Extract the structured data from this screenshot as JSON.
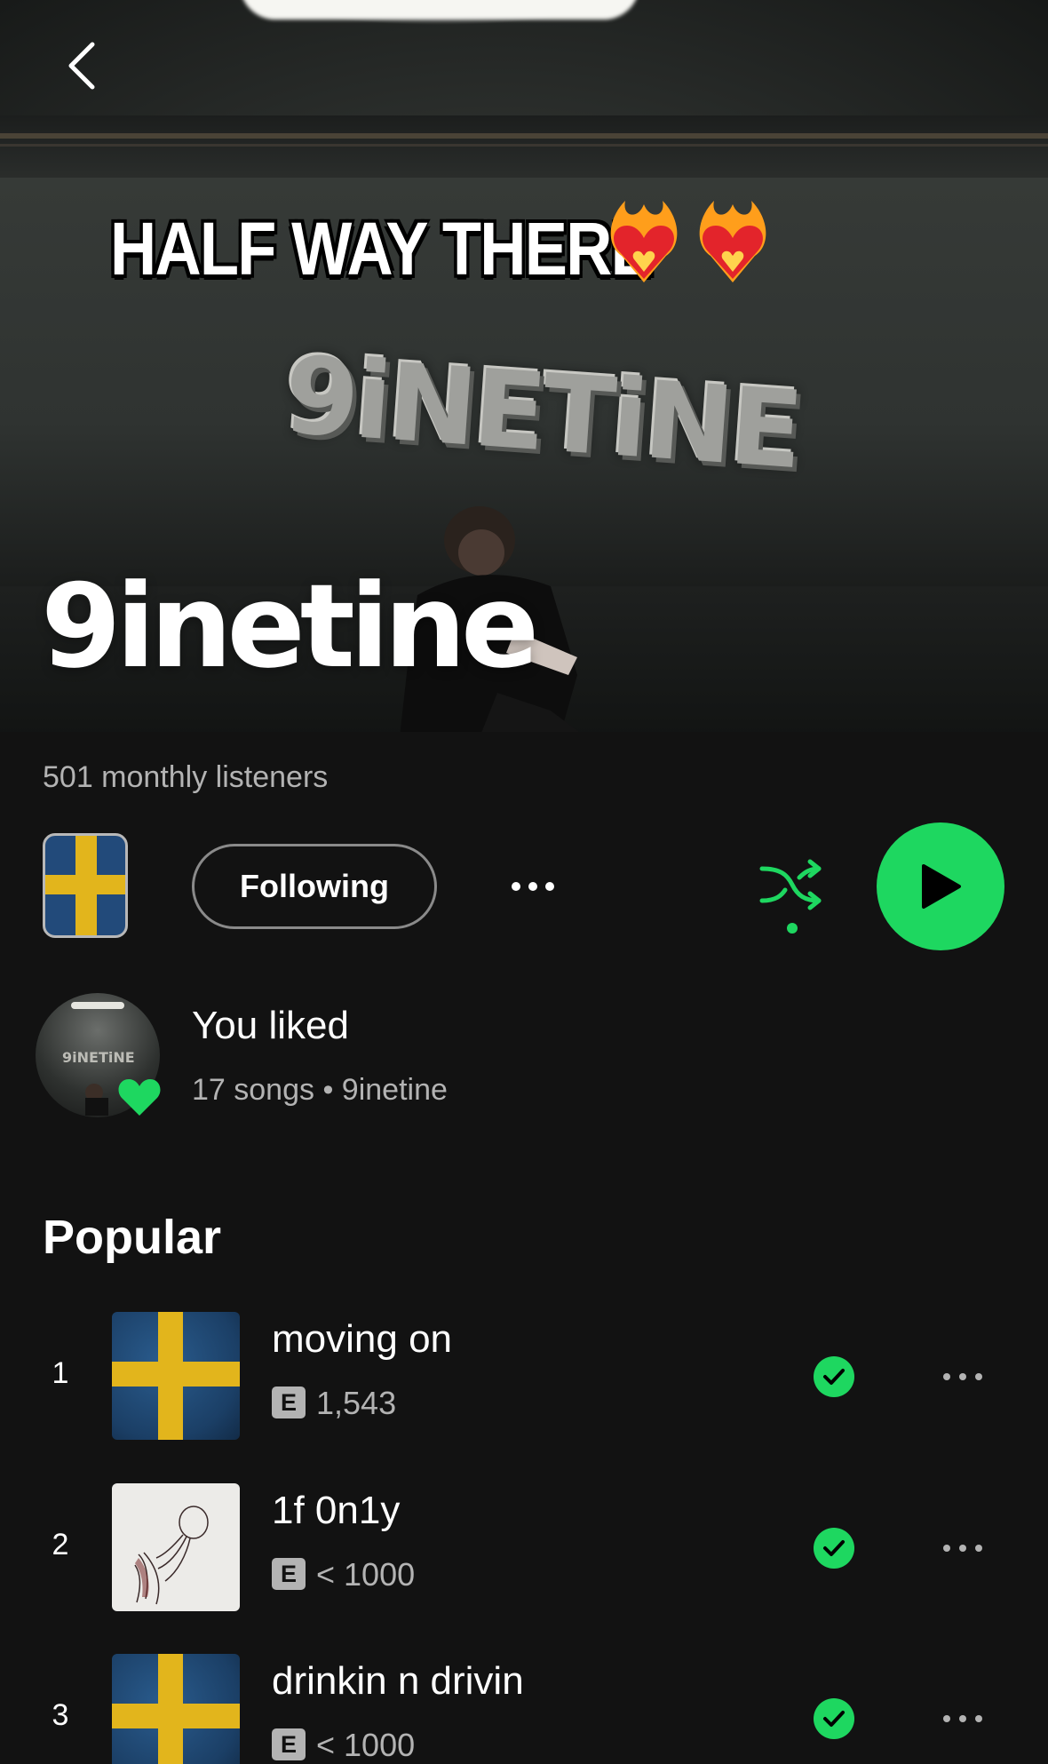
{
  "hero": {
    "banner_text": "HALF WAY THERE",
    "banner_emoji": [
      "heart-on-fire",
      "heart-on-fire"
    ],
    "graffiti_text": "9iNETiNE",
    "artist_name": "9inetine",
    "back_icon": "chevron-left-icon"
  },
  "stats": {
    "monthly_listeners": "501 monthly listeners"
  },
  "actions": {
    "following_label": "Following",
    "more_icon": "more-horizontal-icon",
    "shuffle_icon": "shuffle-icon",
    "play_icon": "play-icon"
  },
  "liked": {
    "title": "You liked",
    "subtitle": "17 songs • 9inetine"
  },
  "popular": {
    "title": "Popular",
    "tracks": [
      {
        "rank": "1",
        "title": "moving on",
        "explicit": "E",
        "plays": "1,543",
        "art": "swedish-flag"
      },
      {
        "rank": "2",
        "title": "1f 0n1y",
        "explicit": "E",
        "plays": "< 1000",
        "art": "sketch"
      },
      {
        "rank": "3",
        "title": "drinkin n drivin",
        "explicit": "E",
        "plays": "< 1000",
        "art": "swedish-flag"
      }
    ]
  },
  "colors": {
    "accent": "#1ed760",
    "background": "#121212",
    "secondary_text": "#b3b3b3"
  }
}
